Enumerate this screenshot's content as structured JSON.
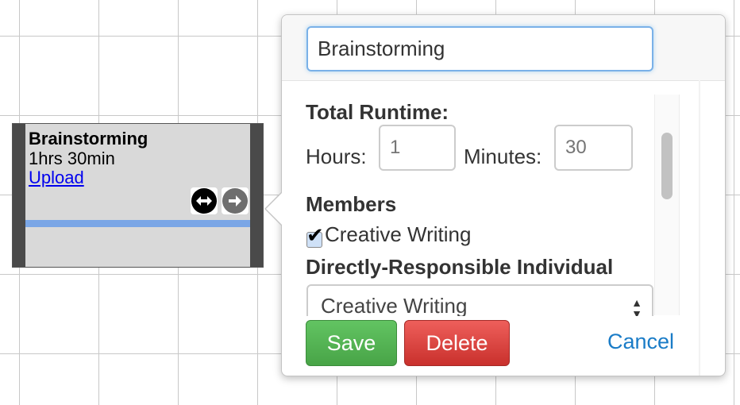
{
  "task_block": {
    "title": "Brainstorming",
    "duration": "1hrs 30min",
    "upload_label": "Upload",
    "icons": [
      "link-circle-icon",
      "arrow-right-circle-icon"
    ]
  },
  "editor": {
    "name_value": "Brainstorming",
    "runtime_heading": "Total Runtime:",
    "hours_label": "Hours:",
    "hours_placeholder": "1",
    "minutes_label": "Minutes:",
    "minutes_placeholder": "30",
    "members_heading": "Members",
    "members": [
      {
        "label": "Creative Writing",
        "checked": true
      }
    ],
    "dri_heading": "Directly-Responsible Individual",
    "dri_selected": "Creative Writing",
    "save_label": "Save",
    "delete_label": "Delete",
    "cancel_label": "Cancel"
  },
  "colors": {
    "progress_bar": "#7aa6e6",
    "save_button": "#48a447",
    "delete_button": "#c9302c",
    "cancel_link": "#1a7cc7",
    "input_focus": "#7ab1e8"
  }
}
